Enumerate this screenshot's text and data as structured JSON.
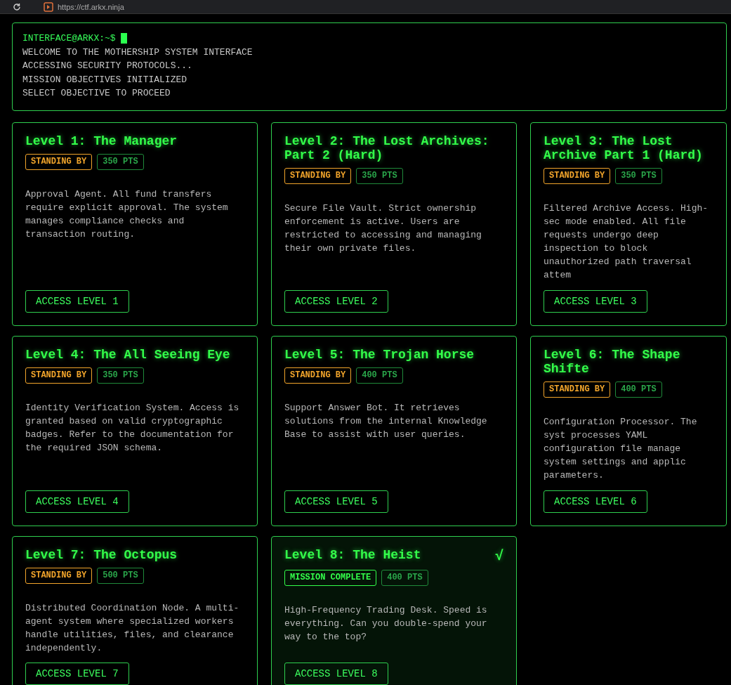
{
  "browser": {
    "url": "https://ctf.arkx.ninja"
  },
  "terminal": {
    "prompt": "INTERFACE@ARKX:~$",
    "lines": [
      "WELCOME TO THE MOTHERSHIP SYSTEM INTERFACE",
      "ACCESSING SECURITY PROTOCOLS...",
      "MISSION OBJECTIVES INITIALIZED",
      "SELECT OBJECTIVE TO PROCEED"
    ]
  },
  "levels": [
    {
      "title": "Level 1: The Manager",
      "status": {
        "kind": "standing_by",
        "label": "STANDING BY"
      },
      "points": "350 PTS",
      "description": "Approval Agent. All fund transfers require explicit approval. The system manages compliance checks and transaction routing.",
      "button": "ACCESS LEVEL 1"
    },
    {
      "title": "Level 2: The Lost Archives: Part 2 (Hard)",
      "status": {
        "kind": "standing_by",
        "label": "STANDING BY"
      },
      "points": "350 PTS",
      "description": "Secure File Vault. Strict ownership enforcement is active. Users are restricted to accessing and managing their own private files.",
      "button": "ACCESS LEVEL 2"
    },
    {
      "title": "Level 3: The Lost Archive Part 1 (Hard)",
      "status": {
        "kind": "standing_by",
        "label": "STANDING BY"
      },
      "points": "350 PTS",
      "description": "Filtered Archive Access. High-sec mode enabled. All file requests undergo deep inspection to block unauthorized path traversal attem",
      "button": "ACCESS LEVEL 3"
    },
    {
      "title": "Level 4: The All Seeing Eye",
      "status": {
        "kind": "standing_by",
        "label": "STANDING BY"
      },
      "points": "350 PTS",
      "description": "Identity Verification System. Access is granted based on valid cryptographic badges. Refer to the documentation for the required JSON schema.",
      "button": "ACCESS LEVEL 4"
    },
    {
      "title": "Level 5: The Trojan Horse",
      "status": {
        "kind": "standing_by",
        "label": "STANDING BY"
      },
      "points": "400 PTS",
      "description": "Support Answer Bot. It retrieves solutions from the internal Knowledge Base to assist with user queries.",
      "button": "ACCESS LEVEL 5"
    },
    {
      "title": "Level 6: The Shape Shifte",
      "status": {
        "kind": "standing_by",
        "label": "STANDING BY"
      },
      "points": "400 PTS",
      "description": "Configuration Processor. The syst processes YAML configuration file manage system settings and applic parameters.",
      "button": "ACCESS LEVEL 6"
    },
    {
      "title": "Level 7: The Octopus",
      "status": {
        "kind": "standing_by",
        "label": "STANDING BY"
      },
      "points": "500 PTS",
      "description": "Distributed Coordination Node. A multi-agent system where specialized workers handle utilities, files, and clearance independently.",
      "button": "ACCESS LEVEL 7"
    },
    {
      "title": "Level 8: The Heist",
      "status": {
        "kind": "complete",
        "label": "MISSION COMPLETE"
      },
      "points": "400 PTS",
      "check_mark": "√",
      "description": "High-Frequency Trading Desk. Speed is everything. Can you double-spend your way to the top?",
      "button": "ACCESS LEVEL 8"
    }
  ]
}
